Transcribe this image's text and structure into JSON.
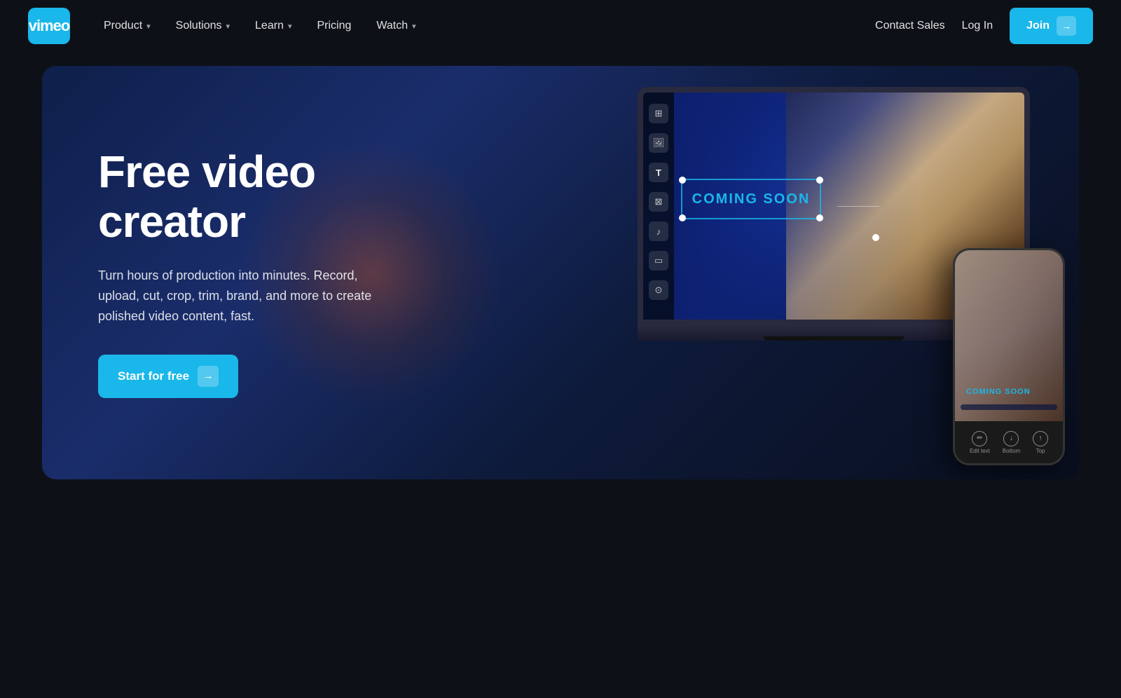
{
  "nav": {
    "logo_text": "vimeo",
    "product_label": "Product",
    "solutions_label": "Solutions",
    "learn_label": "Learn",
    "pricing_label": "Pricing",
    "watch_label": "Watch",
    "contact_sales_label": "Contact Sales",
    "login_label": "Log In",
    "join_label": "Join",
    "join_arrow": "→"
  },
  "hero": {
    "title": "Free video creator",
    "subtitle": "Turn hours of production into minutes. Record, upload, cut, crop, trim, brand, and more to create polished video content, fast.",
    "cta_label": "Start for free",
    "cta_arrow": "→",
    "coming_soon_text": "COMING SOON"
  },
  "phone": {
    "edit_text_label": "Edit text",
    "bottom_label": "Bottom",
    "top_label": "Top"
  },
  "toolbar": {
    "icon1": "⊞",
    "icon2": "🖼",
    "icon3": "T",
    "icon4": "⊠",
    "icon5": "♪",
    "icon6": "▭",
    "icon7": "⊙"
  }
}
